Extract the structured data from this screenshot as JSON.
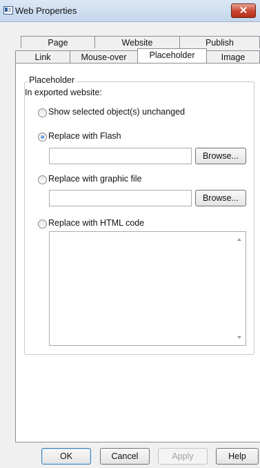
{
  "window": {
    "title": "Web Properties"
  },
  "tabs": {
    "row1": [
      "Page",
      "Website",
      "Publish"
    ],
    "row2": [
      "Link",
      "Mouse-over",
      "Placeholder",
      "Image"
    ],
    "active": "Placeholder"
  },
  "placeholder": {
    "group_title": "Placeholder",
    "intro": "In exported website:",
    "options": {
      "unchanged": {
        "label": "Show selected object(s) unchanged",
        "selected": false
      },
      "flash": {
        "label": "Replace with Flash",
        "selected": true,
        "value": ""
      },
      "graphic": {
        "label": "Replace with graphic file",
        "selected": false,
        "value": ""
      },
      "html": {
        "label": "Replace with HTML code",
        "selected": false,
        "value": ""
      }
    },
    "browse_label": "Browse..."
  },
  "footer": {
    "ok": "OK",
    "cancel": "Cancel",
    "apply": "Apply",
    "help": "Help"
  }
}
